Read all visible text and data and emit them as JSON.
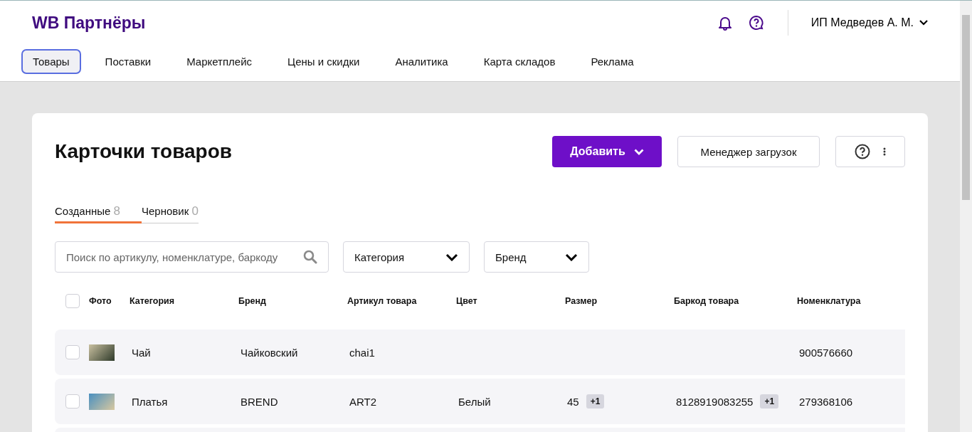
{
  "header": {
    "logo": "WB Партнёры",
    "user": "ИП Медведев А. М."
  },
  "nav": [
    {
      "label": "Товары",
      "selected": true
    },
    {
      "label": "Поставки",
      "selected": false
    },
    {
      "label": "Маркетплейс",
      "selected": false
    },
    {
      "label": "Цены и скидки",
      "selected": false
    },
    {
      "label": "Аналитика",
      "selected": false
    },
    {
      "label": "Карта складов",
      "selected": false
    },
    {
      "label": "Реклама",
      "selected": false
    }
  ],
  "page": {
    "title": "Карточки товаров",
    "add_button": "Добавить",
    "manager_button": "Менеджер загрузок"
  },
  "tabs": [
    {
      "label": "Созданные",
      "count": "8",
      "selected": true
    },
    {
      "label": "Черновик",
      "count": "0",
      "selected": false
    }
  ],
  "filters": {
    "search": {
      "placeholder": "Поиск по артикулу, номенклатуре, баркоду"
    },
    "dropdowns": [
      "Категория",
      "Бренд"
    ]
  },
  "table": {
    "select_all": {
      "checked": false
    },
    "columns": [
      "Фото",
      "Категория",
      "Бренд",
      "Артикул товара",
      "Цвет",
      "Размер",
      "Баркод товара",
      "Номенклатура"
    ],
    "rows": [
      {
        "checked": false,
        "category": "Чай",
        "brand": "Чайковский",
        "article": "chai1",
        "nomenclature": "900576660"
      },
      {
        "checked": false,
        "category": "Платья",
        "brand": "BREND",
        "article": "ART2",
        "shade": "Белый",
        "size": {
          "value": "45",
          "extra": "+1"
        },
        "barcode": {
          "value": "8128919083255",
          "extra": "+1"
        },
        "nomenclature": "279368106"
      }
    ]
  }
}
